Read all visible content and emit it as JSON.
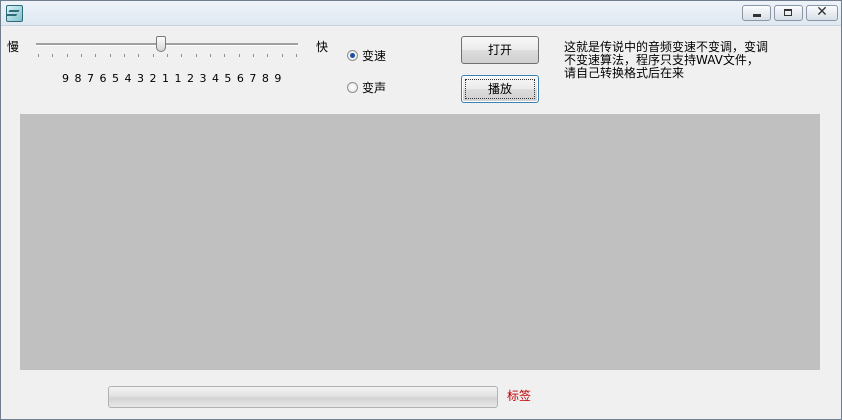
{
  "window": {
    "title": "",
    "controls": {
      "minimize_icon": "minimize-icon",
      "maximize_icon": "maximize-icon",
      "close_glyph": "✕"
    }
  },
  "speed": {
    "slow_label": "慢",
    "fast_label": "快",
    "scale_text": "9 8 7 6 5 4 3 2 1 1 2 3 4 5 6 7 8 9",
    "tick_count": 19
  },
  "mode": {
    "options": [
      {
        "label": "变速",
        "checked": true
      },
      {
        "label": "变声",
        "checked": false
      }
    ]
  },
  "buttons": {
    "open_label": "打开",
    "play_label": "播放"
  },
  "description": "这就是传说中的音频变速不变调，变调不变速算法，程序只支持WAV文件，请自己转换格式后在来",
  "progress": {
    "value": 0
  },
  "status_label": "标签",
  "colors": {
    "panel": "#c0c0c0",
    "status_label": "#c00000"
  }
}
